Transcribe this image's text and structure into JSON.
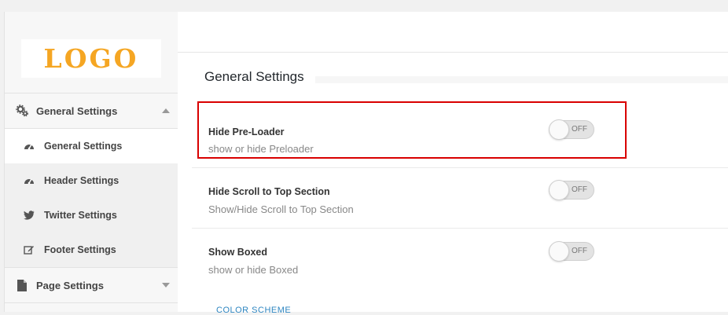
{
  "logo": {
    "text": "LOGO",
    "color": "#f5a623"
  },
  "sidebar": {
    "groups": [
      {
        "label": "General Settings",
        "icon": "gears-icon",
        "expanded": true
      },
      {
        "label": "Page Settings",
        "icon": "page-icon",
        "expanded": false
      }
    ],
    "items": [
      {
        "label": "General Settings",
        "icon": "dashboard-icon",
        "active": true
      },
      {
        "label": "Header Settings",
        "icon": "dashboard-icon",
        "active": false
      },
      {
        "label": "Twitter Settings",
        "icon": "twitter-icon",
        "active": false
      },
      {
        "label": "Footer Settings",
        "icon": "edit-icon",
        "active": false
      }
    ]
  },
  "main": {
    "section_title": "General Settings",
    "settings": [
      {
        "title": "Hide Pre-Loader",
        "description": "show or hide Preloader",
        "state": "OFF",
        "highlighted": true
      },
      {
        "title": "Hide Scroll to Top Section",
        "description": "Show/Hide Scroll to Top Section",
        "state": "OFF",
        "highlighted": false
      },
      {
        "title": "Show Boxed",
        "description": "show or hide Boxed",
        "state": "OFF",
        "highlighted": false
      }
    ],
    "next_section": "COLOR SCHEME"
  },
  "colors": {
    "highlight": "#d90000",
    "accent_link": "#2e86c1"
  }
}
